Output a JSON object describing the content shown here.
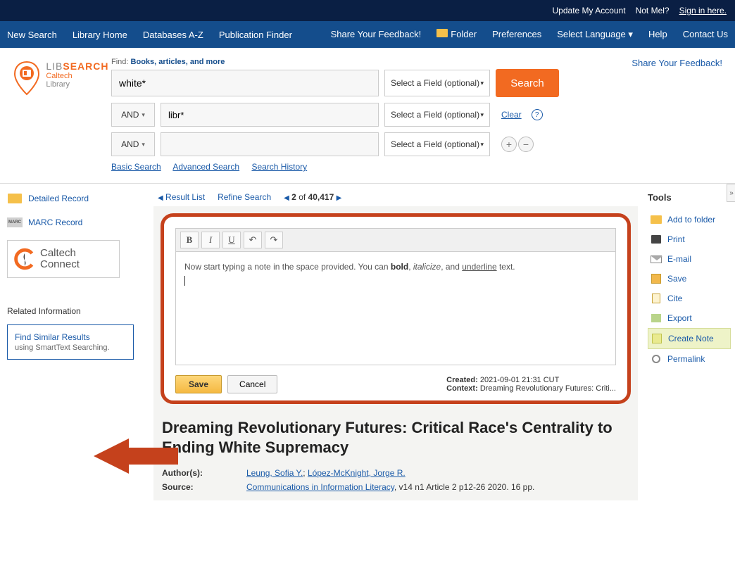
{
  "topbar": {
    "update": "Update My Account",
    "notme": "Not Mel?",
    "signin": "Sign in here."
  },
  "nav": {
    "left": [
      "New Search",
      "Library Home",
      "Databases A-Z",
      "Publication Finder"
    ],
    "right": [
      "Share Your Feedback!",
      "Folder",
      "Preferences",
      "Select Language ▾",
      "Help",
      "Contact Us"
    ]
  },
  "logo": {
    "l1a": "LIB",
    "l1b": "SEARCH",
    "l2": "Caltech",
    "l3": "Library"
  },
  "search": {
    "find_label_a": "Find:",
    "find_label_b": "Books, articles, and more",
    "row1_value": "white*",
    "row2_value": "libr*",
    "row3_value": "",
    "field_label": "Select a Field (optional)",
    "bool": "AND",
    "search_btn": "Search",
    "clear": "Clear",
    "links": [
      "Basic Search",
      "Advanced Search",
      "Search History"
    ]
  },
  "feedback_link": "Share Your Feedback!",
  "left": {
    "detailed": "Detailed Record",
    "marc": "MARC Record",
    "caltech_a": "Caltech",
    "caltech_b": "Connect",
    "related_head": "Related Information",
    "similar_a": "Find Similar Results",
    "similar_b": "using SmartText Searching."
  },
  "pager": {
    "result_list": "Result List",
    "refine": "Refine Search",
    "pos_pre": "2",
    "pos_mid": " of ",
    "pos_total": "40,417"
  },
  "editor": {
    "note_prefix": "Now start typing a note in the space provided. You can ",
    "bold": "bold",
    "sep1": ", ",
    "italic": "italicize",
    "sep2": ", and ",
    "under": "underline",
    "suffix": " text.",
    "save": "Save",
    "cancel": "Cancel",
    "created_lab": "Created:",
    "created_val": "2021-09-01 21:31 CUT",
    "context_lab": "Context:",
    "context_val": "Dreaming Revolutionary Futures: Criti..."
  },
  "record": {
    "title": "Dreaming Revolutionary Futures: Critical Race's Centrality to Ending White Supremacy",
    "authors_lab": "Author(s):",
    "author1": "Leung, Sofia Y.",
    "author_sep": "; ",
    "author2": "López-McKnight, Jorge R.",
    "source_lab": "Source:",
    "source_link": "Communications in Information Literacy",
    "source_tail": ", v14 n1 Article 2 p12-26 2020. 16 pp."
  },
  "tools": {
    "head": "Tools",
    "items": [
      "Add to folder",
      "Print",
      "E-mail",
      "Save",
      "Cite",
      "Export",
      "Create Note",
      "Permalink"
    ]
  }
}
